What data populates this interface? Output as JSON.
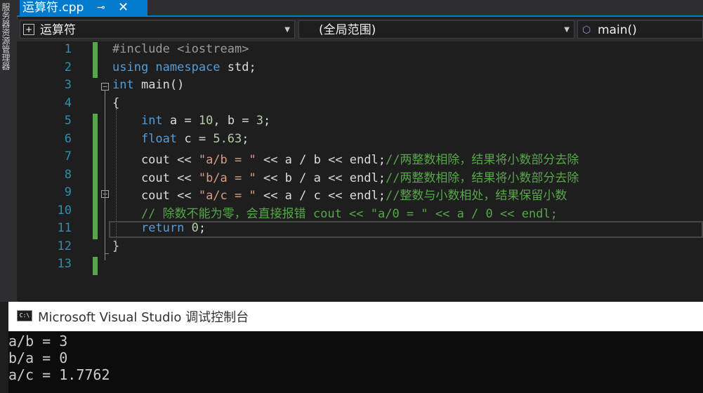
{
  "sidebar": {
    "text": "服务器资源管理器"
  },
  "tab": {
    "title": "运算符.cpp",
    "pin_glyph": "⊸",
    "close_glyph": "✕"
  },
  "navbar": {
    "project": "运算符",
    "scope": "(全局范围)",
    "member": "main()"
  },
  "editor": {
    "lines": [
      {
        "num": "1",
        "segs": [
          {
            "c": "pp",
            "t": "#include <iostream>"
          }
        ]
      },
      {
        "num": "2",
        "segs": [
          {
            "c": "kw",
            "t": "using namespace"
          },
          {
            "c": "",
            "t": " std;"
          }
        ]
      },
      {
        "num": "3",
        "segs": [
          {
            "c": "kw",
            "t": "int"
          },
          {
            "c": "",
            "t": " main()"
          }
        ]
      },
      {
        "num": "4",
        "segs": [
          {
            "c": "",
            "t": "{"
          }
        ]
      },
      {
        "num": "5",
        "segs": [
          {
            "c": "",
            "t": "    "
          },
          {
            "c": "kw",
            "t": "int"
          },
          {
            "c": "",
            "t": " a = "
          },
          {
            "c": "nm",
            "t": "10"
          },
          {
            "c": "",
            "t": ", b = "
          },
          {
            "c": "nm",
            "t": "3"
          },
          {
            "c": "",
            "t": ";"
          }
        ]
      },
      {
        "num": "6",
        "segs": [
          {
            "c": "",
            "t": "    "
          },
          {
            "c": "kw",
            "t": "float"
          },
          {
            "c": "",
            "t": " c = "
          },
          {
            "c": "nm",
            "t": "5.63"
          },
          {
            "c": "",
            "t": ";"
          }
        ]
      },
      {
        "num": "7",
        "segs": [
          {
            "c": "",
            "t": "    cout << "
          },
          {
            "c": "st",
            "t": "\"a/b = \""
          },
          {
            "c": "",
            "t": " << a / b << endl;"
          },
          {
            "c": "cm",
            "t": "//两整数相除，结果将小数部分去除"
          }
        ]
      },
      {
        "num": "8",
        "segs": [
          {
            "c": "",
            "t": "    cout << "
          },
          {
            "c": "st",
            "t": "\"b/a = \""
          },
          {
            "c": "",
            "t": " << b / a << endl;"
          },
          {
            "c": "cm",
            "t": "//两整数相除，结果将小数部分去除"
          }
        ]
      },
      {
        "num": "9",
        "segs": [
          {
            "c": "",
            "t": "    cout << "
          },
          {
            "c": "st",
            "t": "\"a/c = \""
          },
          {
            "c": "",
            "t": " << a / c << endl;"
          },
          {
            "c": "cm",
            "t": "//整数与小数相处，结果保留小数"
          }
        ]
      },
      {
        "num": "10",
        "segs": [
          {
            "c": "cm",
            "t": "    // 除数不能为零，会直接报错 cout << \"a/0 = \" << a / 0 << endl;"
          }
        ]
      },
      {
        "num": "11",
        "segs": [
          {
            "c": "",
            "t": "    "
          },
          {
            "c": "kw",
            "t": "return"
          },
          {
            "c": "",
            "t": " "
          },
          {
            "c": "nm",
            "t": "0"
          },
          {
            "c": "",
            "t": ";"
          }
        ]
      },
      {
        "num": "12",
        "segs": [
          {
            "c": "",
            "t": "}"
          }
        ]
      },
      {
        "num": "13",
        "segs": []
      }
    ]
  },
  "console": {
    "icon": "C:\\",
    "title": "Microsoft Visual Studio 调试控制台",
    "output": [
      "a/b = 3",
      "b/a = 0",
      "a/c = 1.7762"
    ]
  },
  "colors": {
    "accent": "#007acc",
    "keyword": "#569cd6",
    "string": "#d69d85",
    "comment": "#57a64a",
    "number": "#b5cea8",
    "line_number": "#2b91af"
  }
}
